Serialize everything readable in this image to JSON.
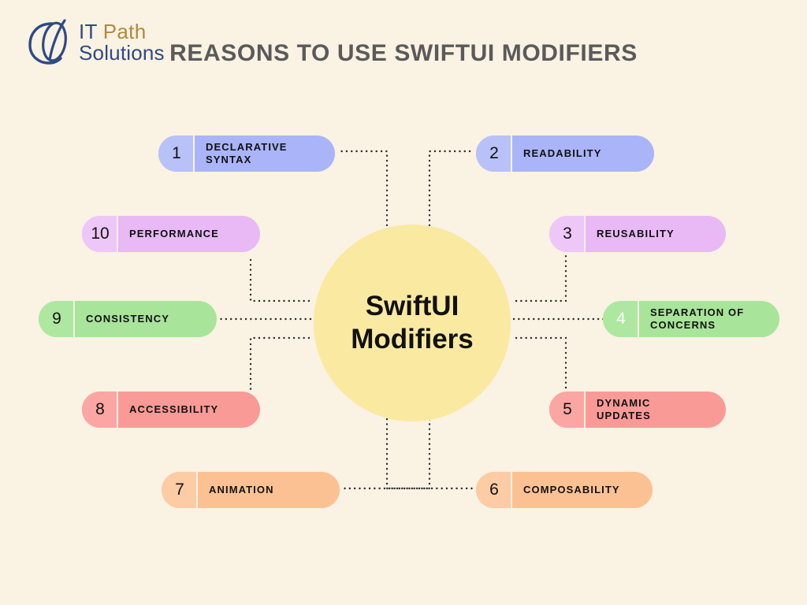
{
  "logo": {
    "icon": "it-path-solutions-logo-mark",
    "line1_it": "IT ",
    "line1_path": "Path",
    "line2": "Solutions"
  },
  "header": {
    "title": "REASONS TO USE\nSWIFTUI MODIFIERS"
  },
  "center": {
    "label": "SwiftUI\nModifiers",
    "color": "#fae9a0"
  },
  "colors": {
    "background": "#faf2e3",
    "title_text": "#5a5a5a",
    "connector": "#2b2b2b",
    "blue": "#aab4f8",
    "blue_num": "#b9c1f9",
    "purple": "#e8b9f5",
    "purple_num": "#edc7f8",
    "green": "#a8e499",
    "green_num": "#aee8a0",
    "red": "#f99a96",
    "red_num": "#fba6a2",
    "orange": "#fcc193",
    "orange_num": "#fdcba4"
  },
  "items": [
    {
      "number": "1",
      "label": "DECLARATIVE\nSYNTAX",
      "color": "#aab4f8",
      "num_color": "#b9c1f9",
      "num_text_color": "#111111"
    },
    {
      "number": "2",
      "label": "READABILITY",
      "color": "#aab4f8",
      "num_color": "#b9c1f9",
      "num_text_color": "#111111"
    },
    {
      "number": "3",
      "label": "REUSABILITY",
      "color": "#e8b9f5",
      "num_color": "#edc7f8",
      "num_text_color": "#111111"
    },
    {
      "number": "4",
      "label": "SEPARATION OF\nCONCERNS",
      "color": "#a8e499",
      "num_color": "#aee8a0",
      "num_text_color": "#ffffff"
    },
    {
      "number": "5",
      "label": "DYNAMIC\nUPDATES",
      "color": "#f99a96",
      "num_color": "#fba6a2",
      "num_text_color": "#111111"
    },
    {
      "number": "6",
      "label": "COMPOSABILITY",
      "color": "#fcc193",
      "num_color": "#fdcba4",
      "num_text_color": "#111111"
    },
    {
      "number": "7",
      "label": "ANIMATION",
      "color": "#fcc193",
      "num_color": "#fdcba4",
      "num_text_color": "#111111"
    },
    {
      "number": "8",
      "label": "ACCESSIBILITY",
      "color": "#f99a96",
      "num_color": "#fba6a2",
      "num_text_color": "#111111"
    },
    {
      "number": "9",
      "label": "CONSISTENCY",
      "color": "#a8e499",
      "num_color": "#aee8a0",
      "num_text_color": "#111111"
    },
    {
      "number": "10",
      "label": "PERFORMANCE",
      "color": "#e8b9f5",
      "num_color": "#edc7f8",
      "num_text_color": "#111111"
    }
  ]
}
